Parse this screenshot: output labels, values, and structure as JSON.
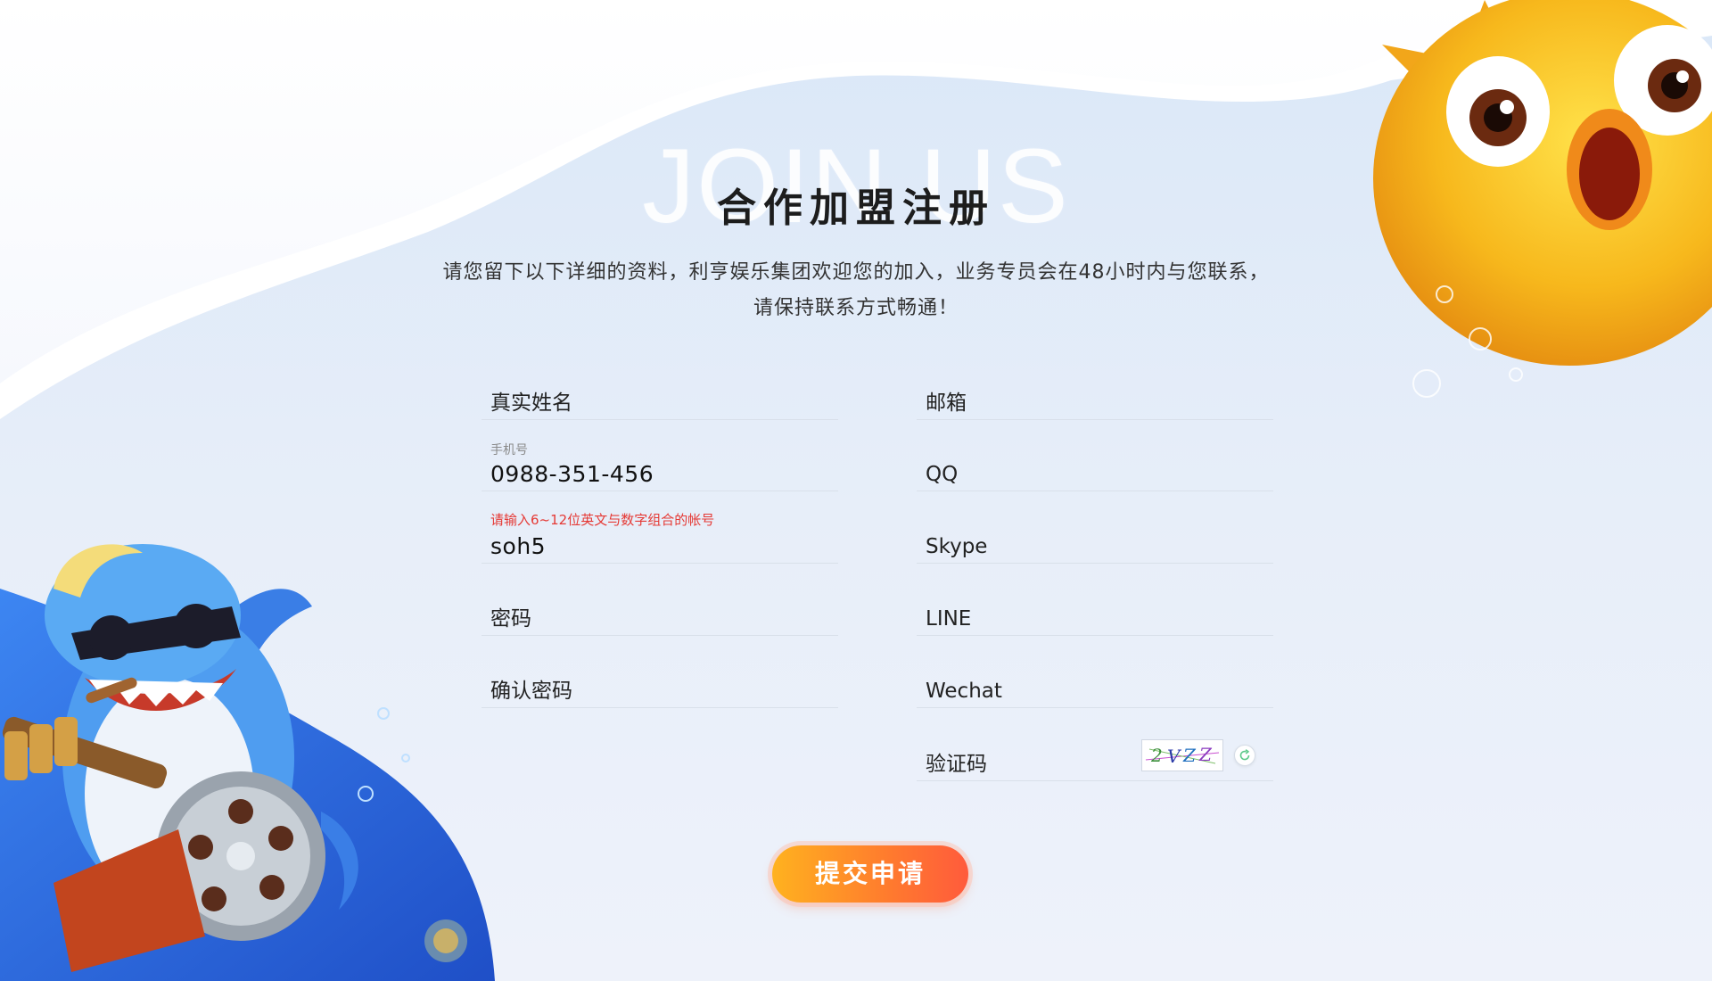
{
  "header": {
    "bg_word": "JOIN US",
    "title": "合作加盟注册",
    "intro_line1": "请您留下以下详细的资料，利亨娱乐集团欢迎您的加入，业务专员会在48小时内与您联系，",
    "intro_line2": "请保持联系方式畅通！"
  },
  "form": {
    "real_name": {
      "placeholder": "真实姓名"
    },
    "phone": {
      "label": "手机号",
      "value": "0988-351-456"
    },
    "account": {
      "error": "请输入6~12位英文与数字组合的帐号",
      "value": "soh5"
    },
    "password": {
      "placeholder": "密码"
    },
    "confirm_password": {
      "placeholder": "确认密码"
    },
    "email": {
      "placeholder": "邮箱"
    },
    "qq": {
      "placeholder": "QQ"
    },
    "skype": {
      "placeholder": "Skype"
    },
    "line": {
      "placeholder": "LINE"
    },
    "wechat": {
      "placeholder": "Wechat"
    },
    "captcha": {
      "placeholder": "验证码",
      "code": "2VZZ"
    },
    "submit_label": "提交申请"
  },
  "colors": {
    "accent_start": "#ffb21f",
    "accent_end": "#ff5b3c",
    "error": "#e53935",
    "blue_panel": "#2f6be0"
  },
  "icons": {
    "refresh": "refresh-icon",
    "shark": "shark-mascot",
    "pufferfish": "pufferfish-mascot"
  }
}
